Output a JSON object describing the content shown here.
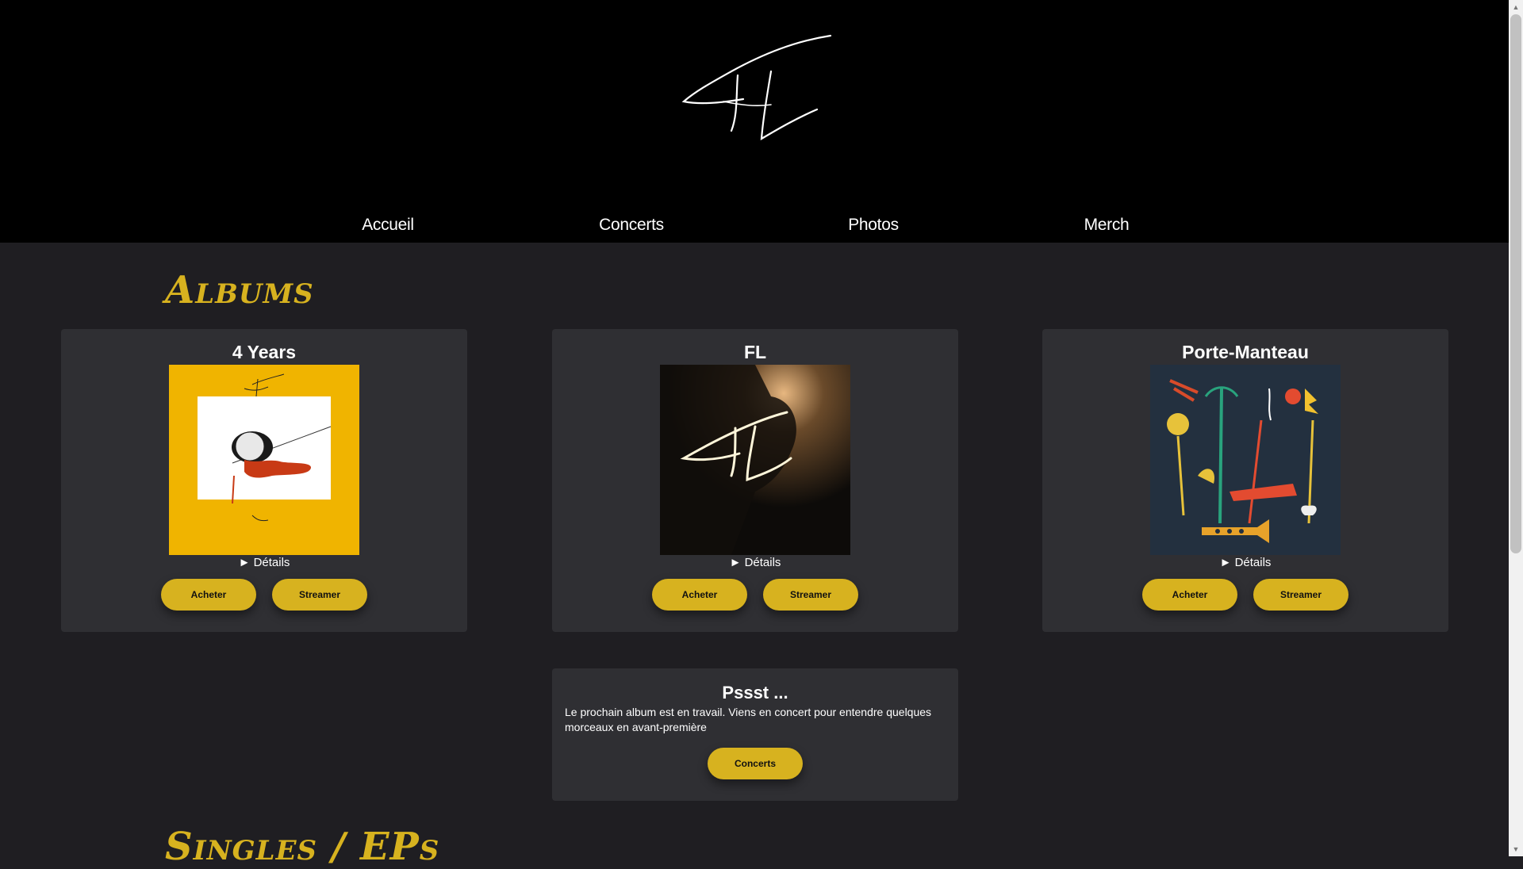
{
  "nav": {
    "items": [
      {
        "label": "Accueil"
      },
      {
        "label": "Concerts"
      },
      {
        "label": "Photos"
      },
      {
        "label": "Merch"
      }
    ]
  },
  "albums_section": {
    "title": "Albums"
  },
  "albums": [
    {
      "title": "4 Years",
      "details": "► Détails",
      "buy": "Acheter",
      "stream": "Streamer"
    },
    {
      "title": "FL",
      "details": "► Détails",
      "buy": "Acheter",
      "stream": "Streamer"
    },
    {
      "title": "Porte-Manteau",
      "details": "► Détails",
      "buy": "Acheter",
      "stream": "Streamer"
    }
  ],
  "notice": {
    "title": "Pssst ...",
    "text": "Le prochain album est en travail. Viens en concert pour entendre quelques morceaux en avant-première",
    "button": "Concerts"
  },
  "singles_section": {
    "title": "Singles / EPs"
  },
  "colors": {
    "accent": "#d7b21f",
    "card": "#2f2f33",
    "background": "#1f1e22",
    "header": "#000000"
  },
  "icons": [
    "fl-logo",
    "scroll-up-icon",
    "scroll-down-icon"
  ]
}
